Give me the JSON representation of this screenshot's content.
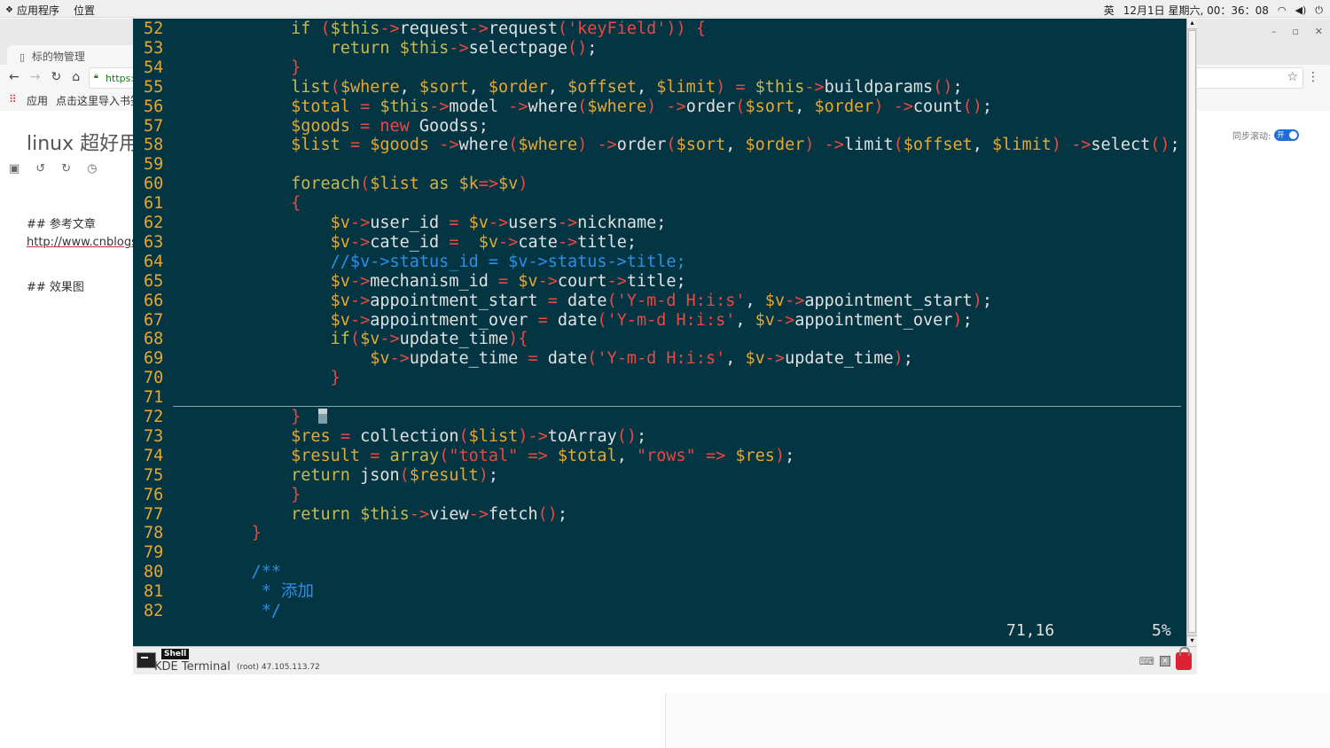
{
  "topbar": {
    "apps": "应用程序",
    "places": "位置",
    "ime": "英",
    "datetime": "12月1日 星期六, 00：36：08"
  },
  "browser": {
    "tab_title": "标的物管理",
    "address": "https:/",
    "bookmarks_apps": "应用",
    "bookmarks_import": "点击这里导入书签"
  },
  "editor_page": {
    "doc_title": "linux 超好用",
    "heading_refs": "## 参考文章",
    "ref_link": "http://www.cnblogs",
    "heading_effect": "## 效果图",
    "sync_label": "同步滚动:",
    "sync_state": "开"
  },
  "terminal": {
    "shell_tab": "Shell",
    "app_name": "KDE Terminal",
    "host": "(root) 47.105.113.72",
    "cursor_pos": "71,16",
    "scroll_pct": "5%",
    "lines": [
      {
        "n": "52",
        "t": "            if ($this->request->request('keyField')) {"
      },
      {
        "n": "53",
        "t": "                return $this->selectpage();"
      },
      {
        "n": "54",
        "t": "            }"
      },
      {
        "n": "55",
        "t": "            list($where, $sort, $order, $offset, $limit) = $this->buildparams();"
      },
      {
        "n": "56",
        "t": "            $total = $this->model ->where($where) ->order($sort, $order) ->count();"
      },
      {
        "n": "57",
        "t": "            $goods = new Goodss;"
      },
      {
        "n": "58",
        "t": "            $list = $goods ->where($where) ->order($sort, $order) ->limit($offset, $limit) ->select();"
      },
      {
        "n": "59",
        "t": ""
      },
      {
        "n": "60",
        "t": "            foreach($list as $k=>$v)"
      },
      {
        "n": "61",
        "t": "            {"
      },
      {
        "n": "62",
        "t": "                $v->user_id = $v->users->nickname;"
      },
      {
        "n": "63",
        "t": "                $v->cate_id =  $v->cate->title;"
      },
      {
        "n": "64",
        "t": "                //$v->status_id = $v->status->title;"
      },
      {
        "n": "65",
        "t": "                $v->mechanism_id = $v->court->title;"
      },
      {
        "n": "66",
        "t": "                $v->appointment_start = date('Y-m-d H:i:s', $v->appointment_start);"
      },
      {
        "n": "67",
        "t": "                $v->appointment_over = date('Y-m-d H:i:s', $v->appointment_over);"
      },
      {
        "n": "68",
        "t": "                if($v->update_time){"
      },
      {
        "n": "69",
        "t": "                    $v->update_time = date('Y-m-d H:i:s', $v->update_time);"
      },
      {
        "n": "70",
        "t": "                }"
      },
      {
        "n": "71",
        "t": ""
      },
      {
        "n": "72",
        "t": "            }"
      },
      {
        "n": "73",
        "t": "            $res = collection($list)->toArray();"
      },
      {
        "n": "74",
        "t": "            $result = array(\"total\" => $total, \"rows\" => $res);"
      },
      {
        "n": "75",
        "t": "            return json($result);"
      },
      {
        "n": "76",
        "t": "        }"
      },
      {
        "n": "77",
        "t": "        return $this->view->fetch();"
      },
      {
        "n": "78",
        "t": "    }"
      },
      {
        "n": "79",
        "t": ""
      },
      {
        "n": "80",
        "t": "    /**"
      },
      {
        "n": "81",
        "t": "     * 添加"
      },
      {
        "n": "82",
        "t": "     */"
      }
    ]
  }
}
